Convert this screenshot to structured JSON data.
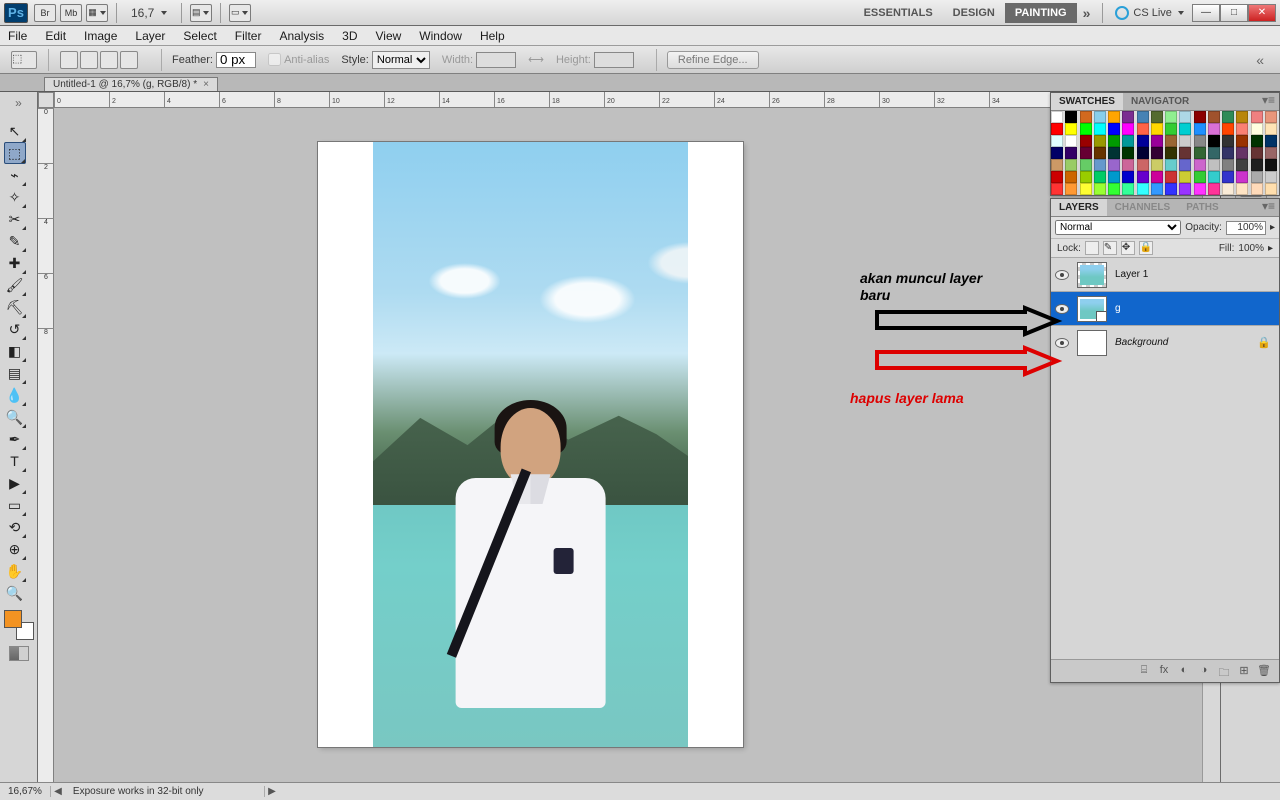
{
  "appbar": {
    "zoom": "16,7",
    "workspaces": [
      "ESSENTIALS",
      "DESIGN",
      "PAINTING"
    ],
    "active_workspace": 2,
    "cslive": "CS Live"
  },
  "menubar": [
    "File",
    "Edit",
    "Image",
    "Layer",
    "Select",
    "Filter",
    "Analysis",
    "3D",
    "View",
    "Window",
    "Help"
  ],
  "options": {
    "feather_label": "Feather:",
    "feather_value": "0 px",
    "antialias": "Anti-alias",
    "style_label": "Style:",
    "style_value": "Normal",
    "width_label": "Width:",
    "height_label": "Height:",
    "refine": "Refine Edge..."
  },
  "document": {
    "tab": "Untitled-1 @ 16,7% (g, RGB/8) *"
  },
  "ruler_h": [
    "0",
    "2",
    "4",
    "6",
    "8",
    "10",
    "12",
    "14",
    "16",
    "18",
    "20",
    "22",
    "24",
    "26",
    "28",
    "30",
    "32",
    "34"
  ],
  "ruler_v": [
    "0",
    "2",
    "4",
    "6",
    "8"
  ],
  "swatch_panel": {
    "tabs": [
      "SWATCHES",
      "NAVIGATOR"
    ],
    "active": 0,
    "colors": [
      "#ffffff",
      "#000000",
      "#d2691e",
      "#87ceeb",
      "#ffa500",
      "#7b2d91",
      "#4682b4",
      "#556b2f",
      "#90ee90",
      "#add8e6",
      "#8b0000",
      "#a0522d",
      "#2e8b57",
      "#b8860b",
      "#f08080",
      "#e9967a",
      "#ff0000",
      "#ffff00",
      "#00ff00",
      "#00ffff",
      "#0000ff",
      "#ff00ff",
      "#ff6347",
      "#ffd700",
      "#32cd32",
      "#00ced1",
      "#1e90ff",
      "#da70d6",
      "#ff4500",
      "#fa8072",
      "#ffffe0",
      "#ffe4b5",
      "#e0ffff",
      "#ffffff",
      "#990000",
      "#999900",
      "#009900",
      "#009999",
      "#000099",
      "#990099",
      "#996633",
      "#cccccc",
      "#888888",
      "#000000",
      "#333333",
      "#993300",
      "#003300",
      "#003366",
      "#000066",
      "#330066",
      "#660033",
      "#663300",
      "#003333",
      "#003300",
      "#000033",
      "#330033",
      "#333300",
      "#663333",
      "#336633",
      "#336666",
      "#333366",
      "#663366",
      "#663333",
      "#996666",
      "#cc9966",
      "#99cc66",
      "#66cc66",
      "#6699cc",
      "#9966cc",
      "#cc6699",
      "#cc6666",
      "#cccc66",
      "#66cccc",
      "#6666cc",
      "#cc66cc",
      "#c0c0c0",
      "#808080",
      "#404040",
      "#202020",
      "#101010",
      "#cc0000",
      "#cc6600",
      "#99cc00",
      "#00cc66",
      "#0099cc",
      "#0000cc",
      "#6600cc",
      "#cc0099",
      "#cc3333",
      "#cccc33",
      "#33cc33",
      "#33cccc",
      "#3333cc",
      "#cc33cc",
      "#aaaaaa",
      "#cccccc",
      "#ff3333",
      "#ff9933",
      "#ffff33",
      "#99ff33",
      "#33ff33",
      "#33ff99",
      "#33ffff",
      "#3399ff",
      "#3333ff",
      "#9933ff",
      "#ff33ff",
      "#ff3399",
      "#faebd7",
      "#ffe4c4",
      "#ffdab9",
      "#ffdead"
    ]
  },
  "layers_panel": {
    "tabs": [
      "LAYERS",
      "CHANNELS",
      "PATHS"
    ],
    "active": 0,
    "blend": "Normal",
    "opacity_label": "Opacity:",
    "opacity": "100%",
    "fill_label": "Fill:",
    "fill": "100%",
    "lock_label": "Lock:",
    "layers": [
      {
        "name": "Layer 1",
        "selected": false
      },
      {
        "name": "g",
        "selected": true,
        "smart": true
      },
      {
        "name": "Background",
        "selected": false,
        "locked": true,
        "italic": true
      }
    ]
  },
  "annotations": {
    "text1_a": "akan muncul layer",
    "text1_b": "baru",
    "text2": "hapus layer lama"
  },
  "status": {
    "zoom": "16,67%",
    "msg": "Exposure works in 32-bit only"
  }
}
